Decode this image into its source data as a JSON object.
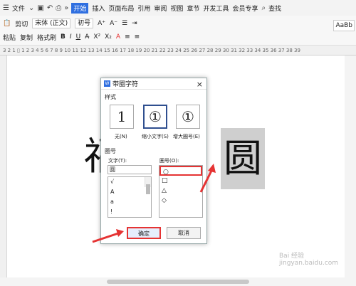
{
  "menubar": {
    "file": "文件",
    "file_chevron": "⌄",
    "more": "»",
    "tabs": [
      "开始",
      "插入",
      "页面布局",
      "引用",
      "审阅",
      "视图",
      "章节",
      "开发工具",
      "会员专享"
    ],
    "search": "查找"
  },
  "ribbon": {
    "cut": "剪切",
    "paste": "粘贴",
    "copy": "复制",
    "format_painter": "格式刷",
    "font": "宋体 (正文)",
    "size": "初号",
    "bold": "B",
    "italic": "I",
    "underline": "U",
    "style_preview": "AaBb"
  },
  "ruler": "3  2  1  ▯  1  2  3  4  5  6  7  8  9  10  11  12  13  14  15  16  17  18  19  20  21  22  23  24  25  26  27  28  29  30  31  32  33  34  35  36  37  38  39",
  "document": {
    "char_left": "福",
    "char_right": "圆"
  },
  "dialog": {
    "title": "带圈字符",
    "close": "×",
    "style_section": "样式",
    "styles": [
      {
        "glyph": "1",
        "label": "无(N)"
      },
      {
        "glyph": "①",
        "label": "缩小文字(S)"
      },
      {
        "glyph": "①",
        "label": "增大圈号(E)"
      }
    ],
    "circle_section": "圈号",
    "text_label": "文字(T):",
    "text_value": "圆",
    "text_list": [
      "√",
      "A",
      "a",
      "!"
    ],
    "enclosure_label": "圈号(O):",
    "enclosures": [
      "○",
      "□",
      "△",
      "◇"
    ],
    "ok": "确定",
    "cancel": "取消"
  },
  "watermark": "Bai 经验 jingyan.baidu.com",
  "colors": {
    "accent": "#2f6fe0",
    "arrow": "#e53333",
    "highlight": "#cfcfcf"
  }
}
